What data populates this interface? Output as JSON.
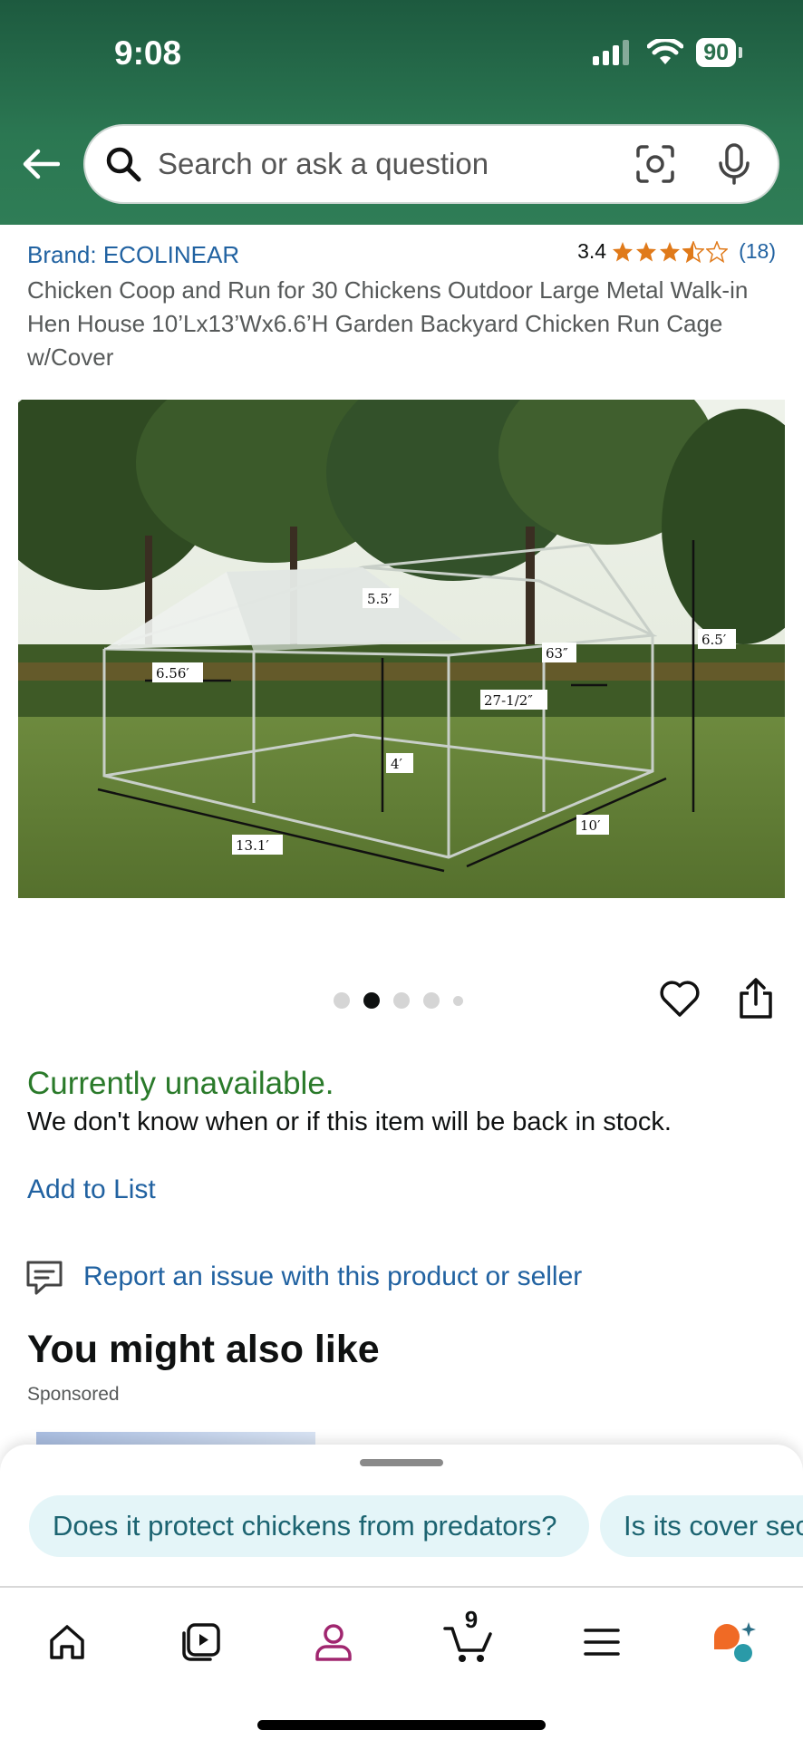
{
  "status_bar": {
    "time": "9:08",
    "battery": "90"
  },
  "search": {
    "placeholder": "Search or ask a question"
  },
  "product": {
    "brand": "Brand: ECOLINEAR",
    "rating_value": "3.4",
    "rating_count": "(18)",
    "title": "Chicken Coop and Run for 30 Chickens Outdoor Large Metal Walk-in Hen House 10’Lx13’Wx6.6’H Garden Backyard Chicken Run Cage w/Cover",
    "image_labels": {
      "roof_width": "5.5′",
      "side_height_left": "6.56′",
      "total_height": "6.5′",
      "door_height": "63″",
      "door_width": "27-1/2″",
      "wall_height": "4′",
      "length": "13.1′",
      "width": "10′"
    },
    "image_count": 5,
    "current_image": 2
  },
  "availability": {
    "status": "Currently unavailable.",
    "note": "We don't know when or if this item will be back in stock."
  },
  "actions": {
    "add_to_list": "Add to List",
    "report": "Report an issue with this product or seller"
  },
  "recommendations": {
    "heading": "You might also like",
    "sponsored": "Sponsored"
  },
  "suggestions": [
    "Does it protect chickens from predators?",
    "Is its cover sec"
  ],
  "nav": {
    "cart_count": "9",
    "items": [
      "home-icon",
      "video-icon",
      "profile-icon",
      "cart-icon",
      "menu-icon",
      "rufus-icon"
    ]
  },
  "colors": {
    "header": "#2b7752",
    "link": "#2162a1",
    "available": "#2a7a2a",
    "star": "#e07a1a",
    "profile": "#a0266f"
  }
}
